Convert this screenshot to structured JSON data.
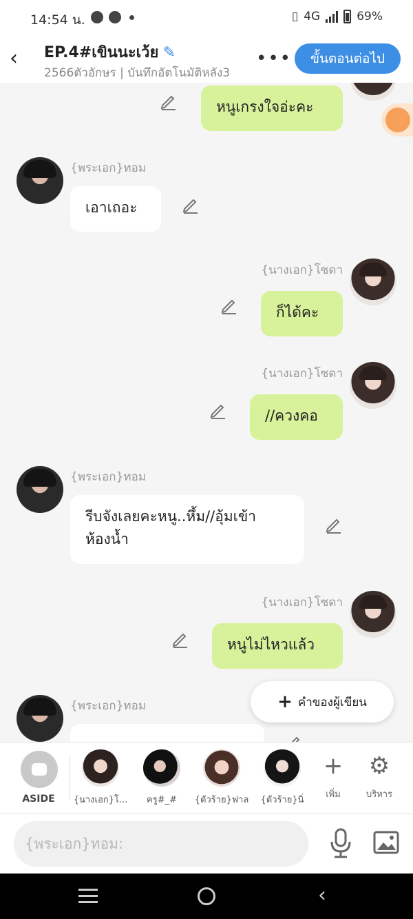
{
  "status_bar": {
    "time": "14:54 น.",
    "network": "4G",
    "battery": "69%"
  },
  "header": {
    "title": "EP.4#เขินนะเว้ย",
    "subtitle": "2566ตัวอักษร | บันทึกอัตโนมัติหลัง3",
    "next_label": "ขั้นตอนต่อไป"
  },
  "chat": {
    "messages": [
      {
        "side": "right",
        "sender": "",
        "text": "หนูเกรงใจอ่ะคะ"
      },
      {
        "side": "left",
        "sender": "{พระเอก}ทอม",
        "text": "เอาเถอะ"
      },
      {
        "side": "right",
        "sender": "{นางเอก}โซดา",
        "text": "ก็ได้คะ"
      },
      {
        "side": "right",
        "sender": "{นางเอก}โซดา",
        "text": "//ควงคอ"
      },
      {
        "side": "left",
        "sender": "{พระเอก}ทอม",
        "text": "รีบจังเลยคะหนู..หึ้ม//อุ้มเข้าห้องน้ำ"
      },
      {
        "side": "right",
        "sender": "{นางเอก}โซดา",
        "text": "หนูไม่ไหวแล้ว"
      },
      {
        "side": "left",
        "sender": "{พระเอก}ทอม",
        "text": ""
      }
    ],
    "authors_note_label": "คำของผู้เขียน"
  },
  "character_bar": {
    "aside_label": "ASIDE",
    "characters": [
      {
        "name": "{นางเอก}โ..."
      },
      {
        "name": "ครู#_#"
      },
      {
        "name": "{ตัวร้าย}ฟาล"
      },
      {
        "name": "{ตัวร้าย}นิ่"
      }
    ],
    "add_label": "เพิ่ม",
    "manage_label": "บริหาร"
  },
  "input": {
    "placeholder": "{พระเอก}ทอม:"
  },
  "colors": {
    "accent": "#3d8fe6",
    "bubble_right": "#d7f29a",
    "bubble_left": "#ffffff"
  }
}
